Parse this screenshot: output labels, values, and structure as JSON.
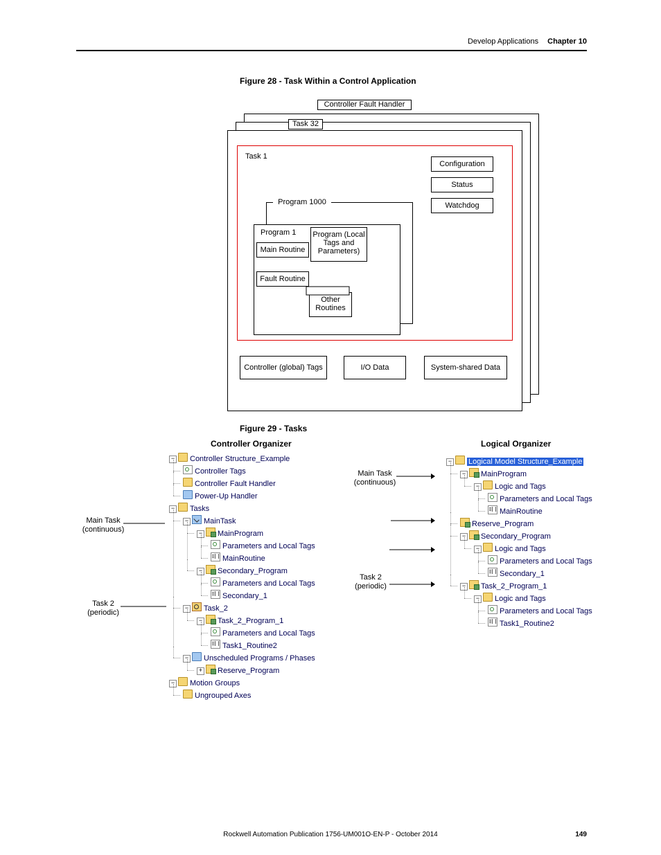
{
  "header": {
    "section": "Develop Applications",
    "chapter": "Chapter 10"
  },
  "figures": {
    "f28_caption": "Figure 28 - Task Within a Control Application",
    "f29_caption": "Figure 29 - Tasks",
    "f28": {
      "ctrl_fault": "Controller Fault Handler",
      "task32": "Task 32",
      "task1": "Task 1",
      "config": "Configuration",
      "status": "Status",
      "watchdog": "Watchdog",
      "prog1000": "Program 1000",
      "prog1": "Program 1",
      "main_routine": "Main Routine",
      "fault_routine": "Fault Routine",
      "prog_local": "Program (Local Tags and Parameters)",
      "other_routines": "Other Routines",
      "global_tags": "Controller (global) Tags",
      "io_data": "I/O Data",
      "sys_shared": "System-shared Data"
    }
  },
  "organizers": {
    "controller_title": "Controller Organizer",
    "logical_title": "Logical Organizer",
    "annotations": {
      "main_task": "Main Task (continuous)",
      "task2": "Task 2 (periodic)"
    },
    "controller_tree": {
      "root": "Controller Structure_Example",
      "controller_tags": "Controller Tags",
      "cfh": "Controller Fault Handler",
      "puh": "Power-Up Handler",
      "tasks": "Tasks",
      "maintask": "MainTask",
      "mainprogram": "MainProgram",
      "plt": "Parameters and Local Tags",
      "mainroutine": "MainRoutine",
      "secondary_program": "Secondary_Program",
      "secondary_1": "Secondary_1",
      "task_2": "Task_2",
      "t2p1": "Task_2_Program_1",
      "t1r2": "Task1_Routine2",
      "unsched": "Unscheduled Programs / Phases",
      "reserve": "Reserve_Program",
      "motion": "Motion Groups",
      "ungrouped": "Ungrouped Axes"
    },
    "logical_tree": {
      "root": "Logical Model Structure_Example",
      "mainprogram": "MainProgram",
      "logic_tags": "Logic and Tags",
      "plt": "Parameters and Local Tags",
      "mainroutine": "MainRoutine",
      "reserve": "Reserve_Program",
      "secondary_program": "Secondary_Program",
      "secondary_1": "Secondary_1",
      "t2p1": "Task_2_Program_1",
      "t1r2": "Task1_Routine2"
    }
  },
  "footer": {
    "pub": "Rockwell Automation Publication 1756-UM001O-EN-P - October 2014",
    "page": "149"
  }
}
